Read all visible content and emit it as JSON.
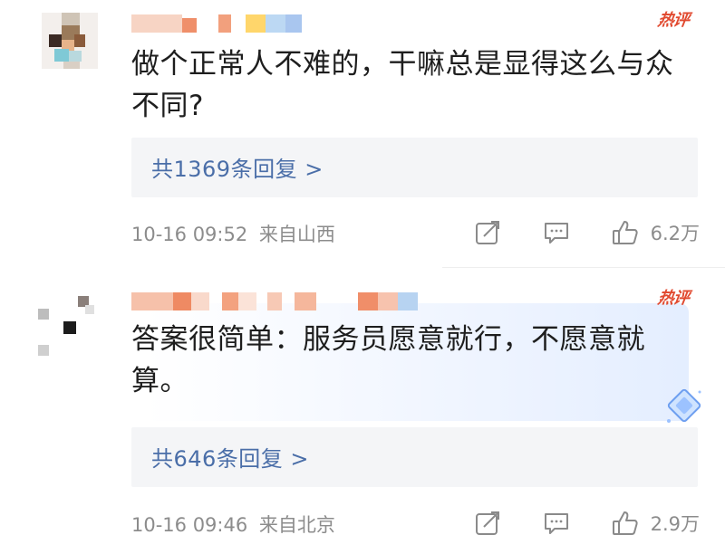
{
  "comments": [
    {
      "badge": "热评",
      "text": "做个正常人不难的，干嘛总是显得这么与众不同?",
      "reply_summary": "共1369条回复 >",
      "time": "10-16 09:52",
      "location": "来自山西",
      "likes": "6.2万"
    },
    {
      "badge": "热评",
      "text": "答案很简单：服务员愿意就行，不愿意就算。",
      "reply_summary": "共646条回复 >",
      "time": "10-16 09:46",
      "location": "来自北京",
      "likes": "2.9万"
    }
  ],
  "icons": {
    "share": "share-icon",
    "comment": "comment-icon",
    "like": "thumbs-up-icon",
    "gem": "diamond-badge-icon"
  },
  "colors": {
    "badge": "#e14a30",
    "reply_link": "#4a6ea8",
    "meta": "#8c8c8c"
  }
}
